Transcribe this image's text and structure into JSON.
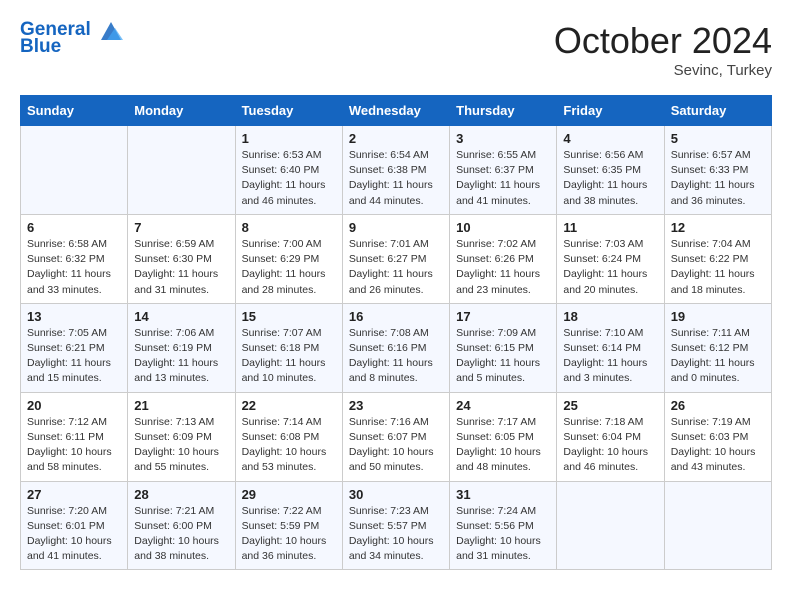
{
  "header": {
    "logo_line1": "General",
    "logo_line2": "Blue",
    "month": "October 2024",
    "location": "Sevinc, Turkey"
  },
  "days_of_week": [
    "Sunday",
    "Monday",
    "Tuesday",
    "Wednesday",
    "Thursday",
    "Friday",
    "Saturday"
  ],
  "weeks": [
    [
      {
        "day": "",
        "info": ""
      },
      {
        "day": "",
        "info": ""
      },
      {
        "day": "1",
        "info": "Sunrise: 6:53 AM\nSunset: 6:40 PM\nDaylight: 11 hours and 46 minutes."
      },
      {
        "day": "2",
        "info": "Sunrise: 6:54 AM\nSunset: 6:38 PM\nDaylight: 11 hours and 44 minutes."
      },
      {
        "day": "3",
        "info": "Sunrise: 6:55 AM\nSunset: 6:37 PM\nDaylight: 11 hours and 41 minutes."
      },
      {
        "day": "4",
        "info": "Sunrise: 6:56 AM\nSunset: 6:35 PM\nDaylight: 11 hours and 38 minutes."
      },
      {
        "day": "5",
        "info": "Sunrise: 6:57 AM\nSunset: 6:33 PM\nDaylight: 11 hours and 36 minutes."
      }
    ],
    [
      {
        "day": "6",
        "info": "Sunrise: 6:58 AM\nSunset: 6:32 PM\nDaylight: 11 hours and 33 minutes."
      },
      {
        "day": "7",
        "info": "Sunrise: 6:59 AM\nSunset: 6:30 PM\nDaylight: 11 hours and 31 minutes."
      },
      {
        "day": "8",
        "info": "Sunrise: 7:00 AM\nSunset: 6:29 PM\nDaylight: 11 hours and 28 minutes."
      },
      {
        "day": "9",
        "info": "Sunrise: 7:01 AM\nSunset: 6:27 PM\nDaylight: 11 hours and 26 minutes."
      },
      {
        "day": "10",
        "info": "Sunrise: 7:02 AM\nSunset: 6:26 PM\nDaylight: 11 hours and 23 minutes."
      },
      {
        "day": "11",
        "info": "Sunrise: 7:03 AM\nSunset: 6:24 PM\nDaylight: 11 hours and 20 minutes."
      },
      {
        "day": "12",
        "info": "Sunrise: 7:04 AM\nSunset: 6:22 PM\nDaylight: 11 hours and 18 minutes."
      }
    ],
    [
      {
        "day": "13",
        "info": "Sunrise: 7:05 AM\nSunset: 6:21 PM\nDaylight: 11 hours and 15 minutes."
      },
      {
        "day": "14",
        "info": "Sunrise: 7:06 AM\nSunset: 6:19 PM\nDaylight: 11 hours and 13 minutes."
      },
      {
        "day": "15",
        "info": "Sunrise: 7:07 AM\nSunset: 6:18 PM\nDaylight: 11 hours and 10 minutes."
      },
      {
        "day": "16",
        "info": "Sunrise: 7:08 AM\nSunset: 6:16 PM\nDaylight: 11 hours and 8 minutes."
      },
      {
        "day": "17",
        "info": "Sunrise: 7:09 AM\nSunset: 6:15 PM\nDaylight: 11 hours and 5 minutes."
      },
      {
        "day": "18",
        "info": "Sunrise: 7:10 AM\nSunset: 6:14 PM\nDaylight: 11 hours and 3 minutes."
      },
      {
        "day": "19",
        "info": "Sunrise: 7:11 AM\nSunset: 6:12 PM\nDaylight: 11 hours and 0 minutes."
      }
    ],
    [
      {
        "day": "20",
        "info": "Sunrise: 7:12 AM\nSunset: 6:11 PM\nDaylight: 10 hours and 58 minutes."
      },
      {
        "day": "21",
        "info": "Sunrise: 7:13 AM\nSunset: 6:09 PM\nDaylight: 10 hours and 55 minutes."
      },
      {
        "day": "22",
        "info": "Sunrise: 7:14 AM\nSunset: 6:08 PM\nDaylight: 10 hours and 53 minutes."
      },
      {
        "day": "23",
        "info": "Sunrise: 7:16 AM\nSunset: 6:07 PM\nDaylight: 10 hours and 50 minutes."
      },
      {
        "day": "24",
        "info": "Sunrise: 7:17 AM\nSunset: 6:05 PM\nDaylight: 10 hours and 48 minutes."
      },
      {
        "day": "25",
        "info": "Sunrise: 7:18 AM\nSunset: 6:04 PM\nDaylight: 10 hours and 46 minutes."
      },
      {
        "day": "26",
        "info": "Sunrise: 7:19 AM\nSunset: 6:03 PM\nDaylight: 10 hours and 43 minutes."
      }
    ],
    [
      {
        "day": "27",
        "info": "Sunrise: 7:20 AM\nSunset: 6:01 PM\nDaylight: 10 hours and 41 minutes."
      },
      {
        "day": "28",
        "info": "Sunrise: 7:21 AM\nSunset: 6:00 PM\nDaylight: 10 hours and 38 minutes."
      },
      {
        "day": "29",
        "info": "Sunrise: 7:22 AM\nSunset: 5:59 PM\nDaylight: 10 hours and 36 minutes."
      },
      {
        "day": "30",
        "info": "Sunrise: 7:23 AM\nSunset: 5:57 PM\nDaylight: 10 hours and 34 minutes."
      },
      {
        "day": "31",
        "info": "Sunrise: 7:24 AM\nSunset: 5:56 PM\nDaylight: 10 hours and 31 minutes."
      },
      {
        "day": "",
        "info": ""
      },
      {
        "day": "",
        "info": ""
      }
    ]
  ]
}
